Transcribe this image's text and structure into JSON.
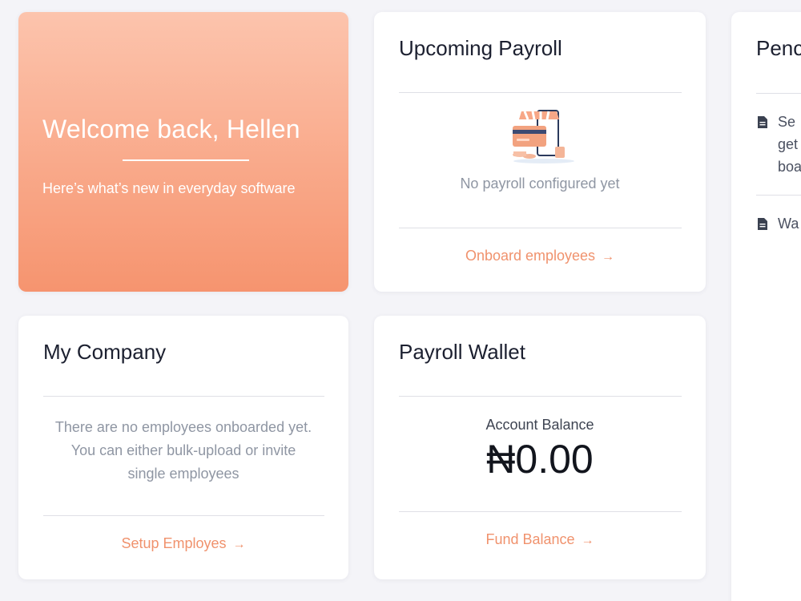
{
  "welcome": {
    "title": "Welcome back, Hellen",
    "subtitle": "Here’s what’s new in everyday software"
  },
  "upcoming_payroll": {
    "title": "Upcoming Payroll",
    "empty_text": "No payroll configured yet",
    "link_label": "Onboard employees",
    "illustration": "payroll-store-card-illustration"
  },
  "my_company": {
    "title": "My Company",
    "description_lines": [
      "There are no employees onboarded yet.",
      "You can either bulk-upload or invite",
      "single employees"
    ],
    "link_label": "Setup Employes"
  },
  "payroll_wallet": {
    "title": "Payroll Wallet",
    "balance_label": "Account Balance",
    "balance_value": "₦0.00",
    "link_label": "Fund Balance"
  },
  "pending": {
    "title": "Penc",
    "items": [
      {
        "lines": [
          "Se",
          "get",
          "boa"
        ],
        "icon": "document-icon"
      },
      {
        "lines": [
          "Wa"
        ],
        "icon": "document-icon"
      }
    ]
  },
  "icons": {
    "arrow": "→"
  },
  "colors": {
    "accent": "#f0926d",
    "welcome_gradient_top": "#fcc4ad",
    "welcome_gradient_bottom": "#f6946f",
    "muted_text": "#8f96a3"
  }
}
